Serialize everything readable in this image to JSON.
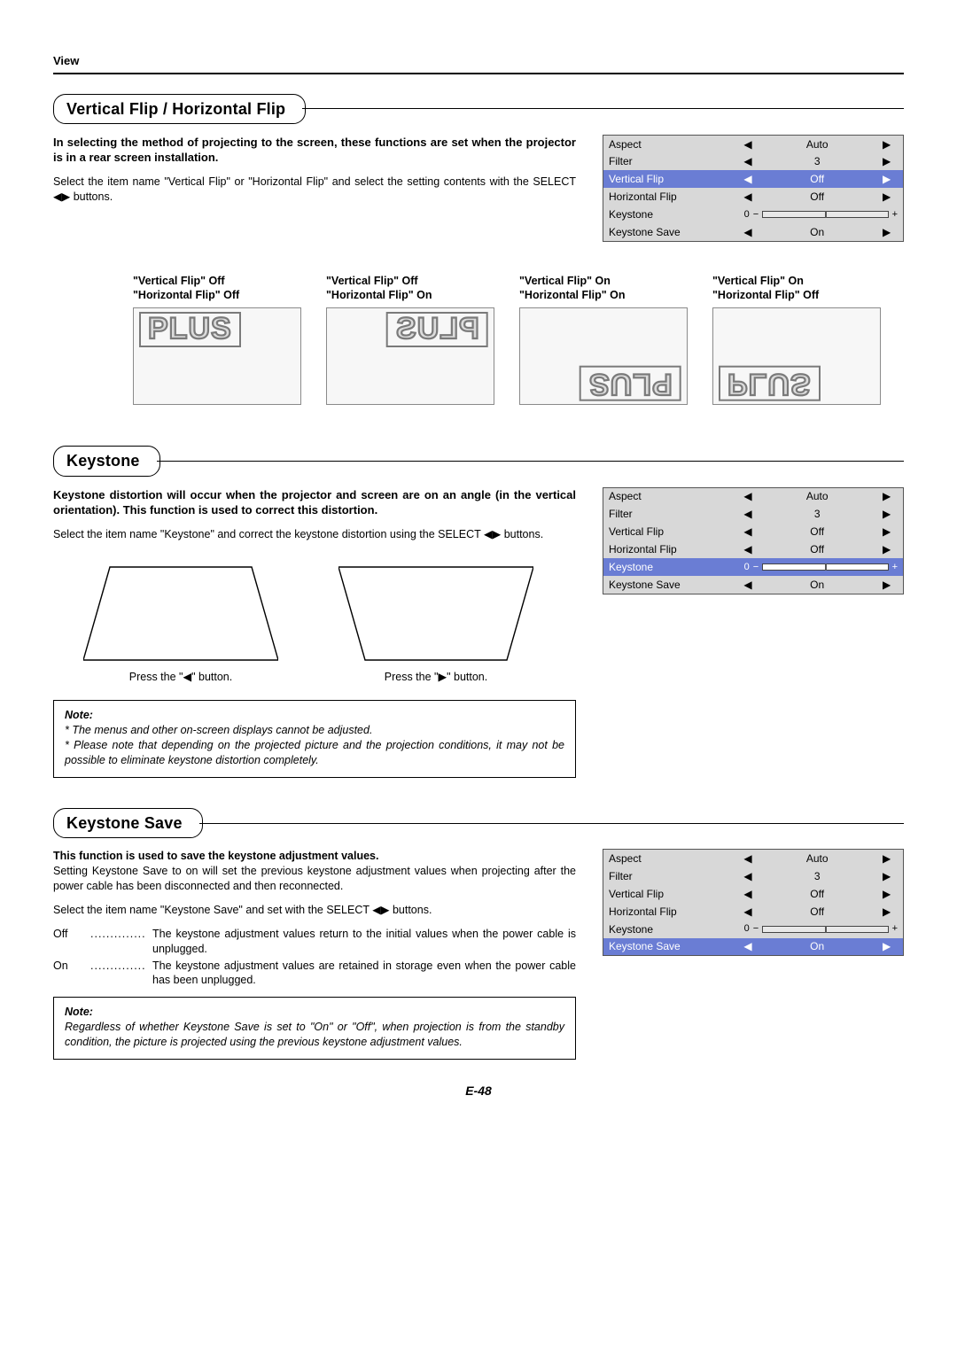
{
  "page": {
    "section_label": "View",
    "footer": "E-48"
  },
  "glyph": {
    "left": "◀",
    "right": "▶",
    "both": "◀▶"
  },
  "sectionA": {
    "title": "Vertical Flip / Horizontal Flip",
    "intro": "In selecting the method of projecting to the screen, these functions are set when the projector is in a rear screen installation.",
    "body_a": "Select the item name \"Vertical Flip\" or \"Horizontal Flip\" and select the setting contents with the SELECT ",
    "body_b": " buttons.",
    "menu": {
      "rows": [
        {
          "label": "Aspect",
          "value": "Auto",
          "type": "lr"
        },
        {
          "label": "Filter",
          "value": "3",
          "type": "lr"
        },
        {
          "label": "Vertical Flip",
          "value": "Off",
          "type": "lr",
          "highlight": true
        },
        {
          "label": "Horizontal Flip",
          "value": "Off",
          "type": "lr"
        },
        {
          "label": "Keystone",
          "value": "0",
          "type": "slider"
        },
        {
          "label": "Keystone Save",
          "value": "On",
          "type": "lr"
        }
      ]
    },
    "examples": [
      {
        "l1": "\"Vertical Flip\" Off",
        "l2": "\"Horizontal Flip\" Off",
        "word": "PLUS",
        "cls": "pos-tl",
        "tx": ""
      },
      {
        "l1": "\"Vertical Flip\" Off",
        "l2": "\"Horizontal Flip\" On",
        "word": "PLUS",
        "cls": "pos-tr",
        "tx": "tx-hflip"
      },
      {
        "l1": "\"Vertical Flip\" On",
        "l2": "\"Horizontal Flip\" On",
        "word": "PLUS",
        "cls": "pos-br",
        "tx": "tx-both"
      },
      {
        "l1": "\"Vertical Flip\" On",
        "l2": "\"Horizontal Flip\" Off",
        "word": "PLUS",
        "cls": "pos-bl",
        "tx": "tx-vflip"
      }
    ]
  },
  "sectionB": {
    "title": "Keystone",
    "intro": "Keystone distortion will occur when the projector and screen are on an angle (in the vertical orientation). This function is used to correct this distortion.",
    "body_a": "Select the item name \"Keystone\" and correct the keystone distortion using the SELECT ",
    "body_b": " buttons.",
    "menu": {
      "rows": [
        {
          "label": "Aspect",
          "value": "Auto",
          "type": "lr"
        },
        {
          "label": "Filter",
          "value": "3",
          "type": "lr"
        },
        {
          "label": "Vertical Flip",
          "value": "Off",
          "type": "lr"
        },
        {
          "label": "Horizontal Flip",
          "value": "Off",
          "type": "lr"
        },
        {
          "label": "Keystone",
          "value": "0",
          "type": "slider",
          "highlight": true
        },
        {
          "label": "Keystone Save",
          "value": "On",
          "type": "lr"
        }
      ]
    },
    "diag": [
      {
        "caption_a": "Press the \"",
        "glyph": "◀",
        "caption_b": "\" button."
      },
      {
        "caption_a": "Press the \"",
        "glyph": "▶",
        "caption_b": "\" button."
      }
    ],
    "note": {
      "heading": "Note:",
      "items": [
        "The menus and other on-screen displays cannot be adjusted.",
        "Please note that depending on the projected picture and the projection conditions, it may not be possible to eliminate keystone distortion completely."
      ]
    }
  },
  "sectionC": {
    "title": "Keystone Save",
    "intro": "This function is used to save the keystone adjustment values.",
    "para": "Setting Keystone Save to on will set the previous keystone adjustment values when projecting after the power cable has been disconnected and then reconnected.",
    "body_a": "Select the item name \"Keystone Save\" and set with the SELECT ",
    "body_b": " buttons.",
    "menu": {
      "rows": [
        {
          "label": "Aspect",
          "value": "Auto",
          "type": "lr"
        },
        {
          "label": "Filter",
          "value": "3",
          "type": "lr"
        },
        {
          "label": "Vertical Flip",
          "value": "Off",
          "type": "lr"
        },
        {
          "label": "Horizontal Flip",
          "value": "Off",
          "type": "lr"
        },
        {
          "label": "Keystone",
          "value": "0",
          "type": "slider"
        },
        {
          "label": "Keystone Save",
          "value": "On",
          "type": "lr",
          "highlight": true
        }
      ]
    },
    "defs": [
      {
        "term": "Off",
        "def": "The keystone adjustment values return to the initial values when the power cable is unplugged."
      },
      {
        "term": "On",
        "def": "The keystone adjustment values are retained in storage even when the power cable has been unplugged."
      }
    ],
    "note": {
      "heading": "Note:",
      "text": "Regardless of whether Keystone Save is set to \"On\" or \"Off\", when projection is from the standby condition, the picture is projected using the previous keystone adjustment values."
    }
  }
}
